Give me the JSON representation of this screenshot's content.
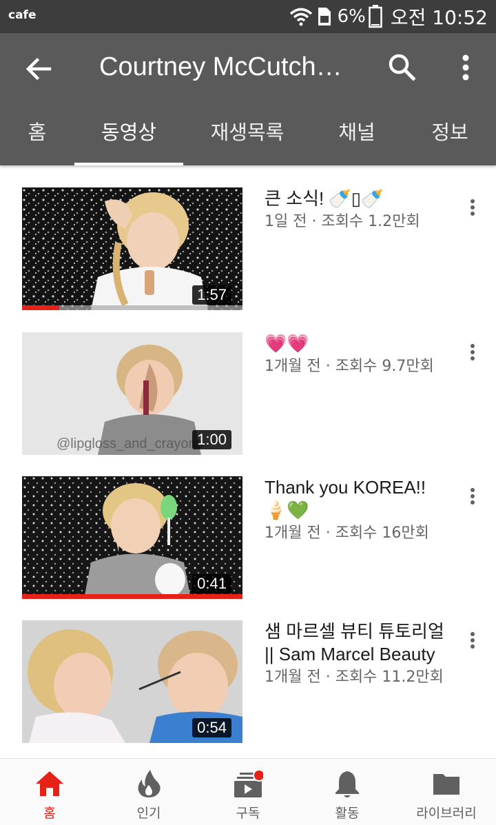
{
  "status_bar": {
    "app_label": "cafe",
    "battery_percent": "6%",
    "time": "오전 10:52"
  },
  "header": {
    "channel_title": "Courtney McCutch…",
    "back_icon": "arrow-left-icon",
    "search_icon": "search-icon",
    "more_icon": "more-vert-icon"
  },
  "tabs": [
    {
      "label": "홈",
      "active": false
    },
    {
      "label": "동영상",
      "active": true
    },
    {
      "label": "재생목록",
      "active": false
    },
    {
      "label": "채널",
      "active": false
    },
    {
      "label": "정보",
      "active": false
    }
  ],
  "videos": [
    {
      "title": "큰 소식! 🍼▯🍼",
      "meta": "1일 전 · 조회수 1.2만회",
      "duration": "1:57",
      "watched_progress": 0.17,
      "watermark": ""
    },
    {
      "title": "💗💗",
      "meta": "1개월 전 · 조회수 9.7만회",
      "duration": "1:00",
      "watched_progress": 0,
      "watermark": "@lipgloss_and_crayons"
    },
    {
      "title": "Thank you KOREA!! 🍦💚",
      "meta": "1개월 전 · 조회수 16만회",
      "duration": "0:41",
      "watched_progress": 1.0,
      "watermark": ""
    },
    {
      "title": "샘 마르셀 뷰티 튜토리얼 || Sam Marcel Beauty",
      "meta": "1개월 전 · 조회수 11.2만회",
      "duration": "0:54",
      "watched_progress": 0,
      "watermark": ""
    }
  ],
  "bottom_nav": [
    {
      "label": "홈",
      "icon": "home-icon",
      "active": true
    },
    {
      "label": "인기",
      "icon": "flame-icon",
      "active": false
    },
    {
      "label": "구독",
      "icon": "subscriptions-icon",
      "active": false
    },
    {
      "label": "활동",
      "icon": "bell-icon",
      "active": false
    },
    {
      "label": "라이브러리",
      "icon": "folder-icon",
      "active": false
    }
  ],
  "colors": {
    "status_bar": "#3d3d3d",
    "app_bar": "#5a5a5a",
    "accent_red": "#e62117"
  }
}
